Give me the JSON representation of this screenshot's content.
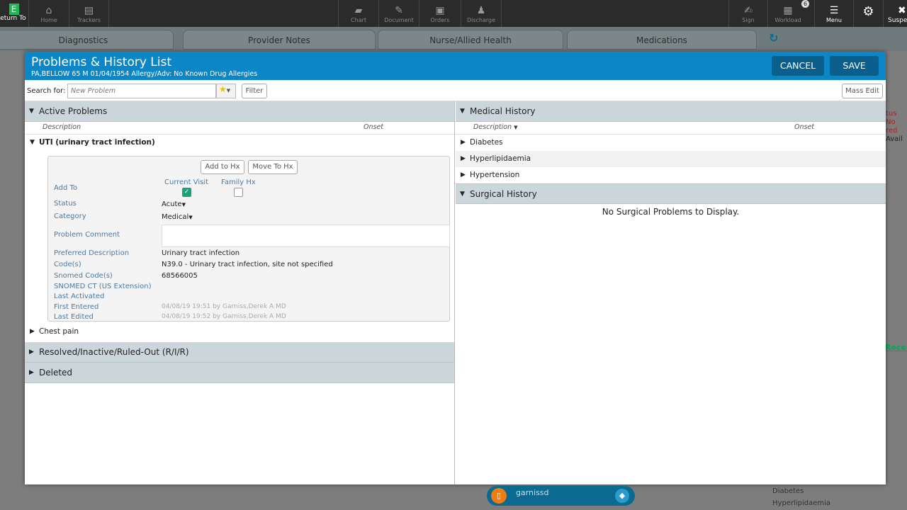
{
  "topbar": {
    "return_to": "Return To",
    "left": [
      {
        "label": "Home",
        "icon": "home-icon"
      },
      {
        "label": "Trackers",
        "icon": "trackers-icon"
      }
    ],
    "right": [
      {
        "label": "Chart",
        "icon": "folder-icon"
      },
      {
        "label": "Document",
        "icon": "pencil-icon"
      },
      {
        "label": "Orders",
        "icon": "orders-icon"
      },
      {
        "label": "Discharge",
        "icon": "discharge-icon"
      }
    ],
    "far": [
      {
        "label": "Sign",
        "icon": "sign-icon"
      },
      {
        "label": "Workload",
        "icon": "calendar-icon",
        "badge": "6"
      },
      {
        "label": "Menu",
        "icon": "menu-icon"
      }
    ],
    "suspend": "Suspend"
  },
  "tabs": [
    "Diagnostics",
    "Provider Notes",
    "Nurse/Allied Health",
    "Medications"
  ],
  "background": {
    "right_status": [
      "tus No",
      "red",
      "Avail"
    ],
    "recent": "Recen",
    "bottom_list": [
      "Diabetes",
      "Hyperlipidaemia"
    ]
  },
  "modal": {
    "title": "Problems & History List",
    "patient": "PA,BELLOW  65  M  01/04/1954   Allergy/Adv: No Known Drug Allergies",
    "cancel": "CANCEL",
    "save": "SAVE",
    "search_label": "Search for:",
    "search_placeholder": "New Problem",
    "filter": "Filter",
    "mass_edit": "Mass Edit"
  },
  "active": {
    "title": "Active Problems",
    "col_desc": "Description",
    "col_onset": "Onset",
    "expanded": {
      "name": "UTI (urinary tract infection)",
      "add_to_hx": "Add to Hx",
      "move_to_hx": "Move To Hx",
      "add_to": "Add To",
      "current_visit": "Current Visit",
      "current_visit_checked": true,
      "family_hx": "Family Hx",
      "family_hx_checked": false,
      "status_label": "Status",
      "status": "Acute",
      "category_label": "Category",
      "category": "Medical",
      "comment_label": "Problem Comment",
      "comment": "",
      "pref_label": "Preferred Description",
      "pref": "Urinary tract infection",
      "codes_label": "Code(s)",
      "codes": "N39.0 - Urinary tract infection, site not specified",
      "snomed_label": "Snomed Code(s)",
      "snomed": "68566005",
      "snomed_us_label": "SNOMED CT (US Extension)",
      "last_activated_label": "Last Activated",
      "first_entered_label": "First Entered",
      "first_entered": "04/08/19 19:51 by Garniss,Derek A MD",
      "last_edited_label": "Last Edited",
      "last_edited": "04/08/19 19:52 by Garniss,Derek A MD"
    },
    "other": "Chest pain"
  },
  "resolved": "Resolved/Inactive/Ruled-Out (R/I/R)",
  "deleted": "Deleted",
  "medical": {
    "title": "Medical History",
    "col_desc": "Description",
    "col_onset": "Onset",
    "items": [
      "Diabetes",
      "Hyperlipidaemia",
      "Hypertension"
    ]
  },
  "surgical": {
    "title": "Surgical History",
    "empty": "No Surgical Problems to Display."
  },
  "dictation": {
    "user": "garnissd"
  }
}
